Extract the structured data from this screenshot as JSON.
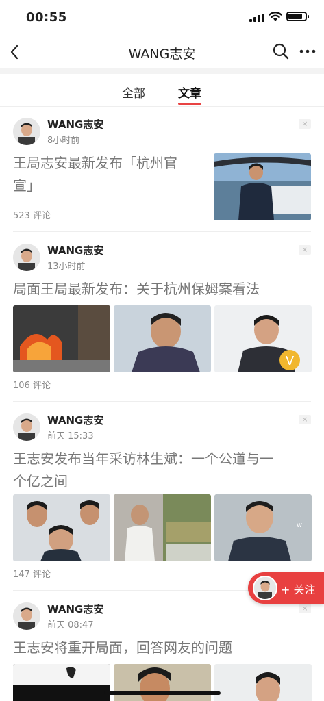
{
  "status": {
    "time": "00:55",
    "battery_level": 0.85
  },
  "nav": {
    "title": "WANG志安",
    "back_icon": "chevron-left-icon",
    "search_icon": "search-icon",
    "more_icon": "more-dots-icon"
  },
  "tabs": [
    {
      "label": "全部"
    },
    {
      "label": "文章",
      "active": true
    }
  ],
  "accent_color": "#e84343",
  "articles": [
    {
      "author": "WANG志安",
      "time": "8小时前",
      "title_line1": "王局志安最新发布「杭州官",
      "title_line2": "宣」",
      "comments": "523 评论",
      "close": "×"
    },
    {
      "author": "WANG志安",
      "time": "13小时前",
      "title_line1": "局面王局最新发布：关于杭州保姆案看法",
      "comments": "106 评论",
      "close": "×"
    },
    {
      "author": "WANG志安",
      "time": "前天 15:33",
      "title_line1": "王志安发布当年采访林生斌：一个公道与一",
      "title_line2": "个亿之间",
      "comments": "147 评论",
      "close": "×"
    },
    {
      "author": "WANG志安",
      "time": "前天 08:47",
      "title_line1": "王志安将重开局面，回答网友的问题",
      "close": "×"
    }
  ],
  "follow": {
    "label": "+ 关注"
  }
}
